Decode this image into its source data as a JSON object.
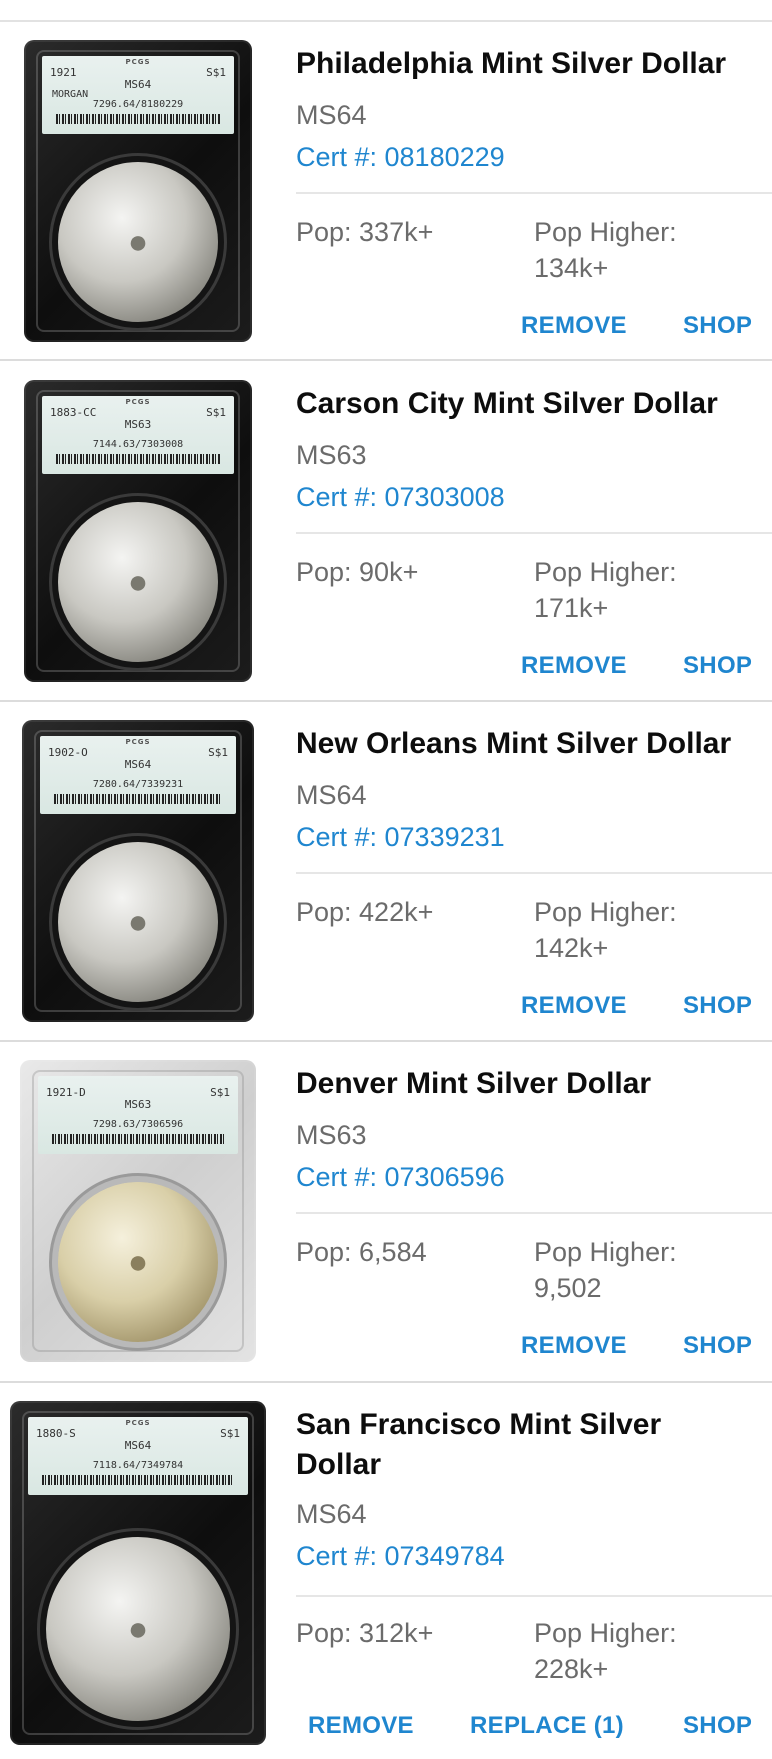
{
  "coins": [
    {
      "title": "Philadelphia Mint Silver Dollar",
      "grade": "MS64",
      "cert": "Cert #: 08180229",
      "pop": "Pop: 337k+",
      "pop_higher_label": "Pop Higher:",
      "pop_higher": "134k+",
      "actions": {
        "remove": "REMOVE",
        "shop": "SHOP"
      },
      "slab": {
        "brand": "PCGS",
        "date": "1921",
        "denom": "S$1",
        "grade": "MS64",
        "variety": "MORGAN",
        "cert": "7296.64/8180229",
        "style": "dark"
      }
    },
    {
      "title": "Carson City Mint Silver Dollar",
      "grade": "MS63",
      "cert": "Cert #: 07303008",
      "pop": "Pop: 90k+",
      "pop_higher_label": "Pop Higher:",
      "pop_higher": "171k+",
      "actions": {
        "remove": "REMOVE",
        "shop": "SHOP"
      },
      "slab": {
        "brand": "PCGS",
        "date": "1883-CC",
        "denom": "S$1",
        "grade": "MS63",
        "variety": "",
        "cert": "7144.63/7303008",
        "style": "dark"
      }
    },
    {
      "title": "New Orleans Mint Silver Dollar",
      "grade": "MS64",
      "cert": "Cert #: 07339231",
      "pop": "Pop: 422k+",
      "pop_higher_label": "Pop Higher:",
      "pop_higher": "142k+",
      "actions": {
        "remove": "REMOVE",
        "shop": "SHOP"
      },
      "slab": {
        "brand": "PCGS",
        "date": "1902-O",
        "denom": "S$1",
        "grade": "MS64",
        "variety": "",
        "cert": "7280.64/7339231",
        "style": "dark"
      }
    },
    {
      "title": "Denver Mint Silver Dollar",
      "grade": "MS63",
      "cert": "Cert #: 07306596",
      "pop": "Pop: 6,584",
      "pop_higher_label": "Pop Higher:",
      "pop_higher": "9,502",
      "actions": {
        "remove": "REMOVE",
        "shop": "SHOP"
      },
      "slab": {
        "brand": "",
        "date": "1921-D",
        "denom": "S$1",
        "grade": "MS63",
        "variety": "",
        "cert": "7298.63/7306596",
        "style": "clear"
      }
    },
    {
      "title": "San Francisco Mint Silver Dollar",
      "grade": "MS64",
      "cert": "Cert #: 07349784",
      "pop": "Pop: 312k+",
      "pop_higher_label": "Pop Higher:",
      "pop_higher": "228k+",
      "actions": {
        "remove": "REMOVE",
        "replace": "REPLACE (1)",
        "shop": "SHOP"
      },
      "slab": {
        "brand": "PCGS",
        "date": "1880-S",
        "denom": "S$1",
        "grade": "MS64",
        "variety": "",
        "cert": "7118.64/7349784",
        "style": "dark"
      }
    }
  ],
  "icons": {
    "coin_slab": "coin-slab-image"
  }
}
